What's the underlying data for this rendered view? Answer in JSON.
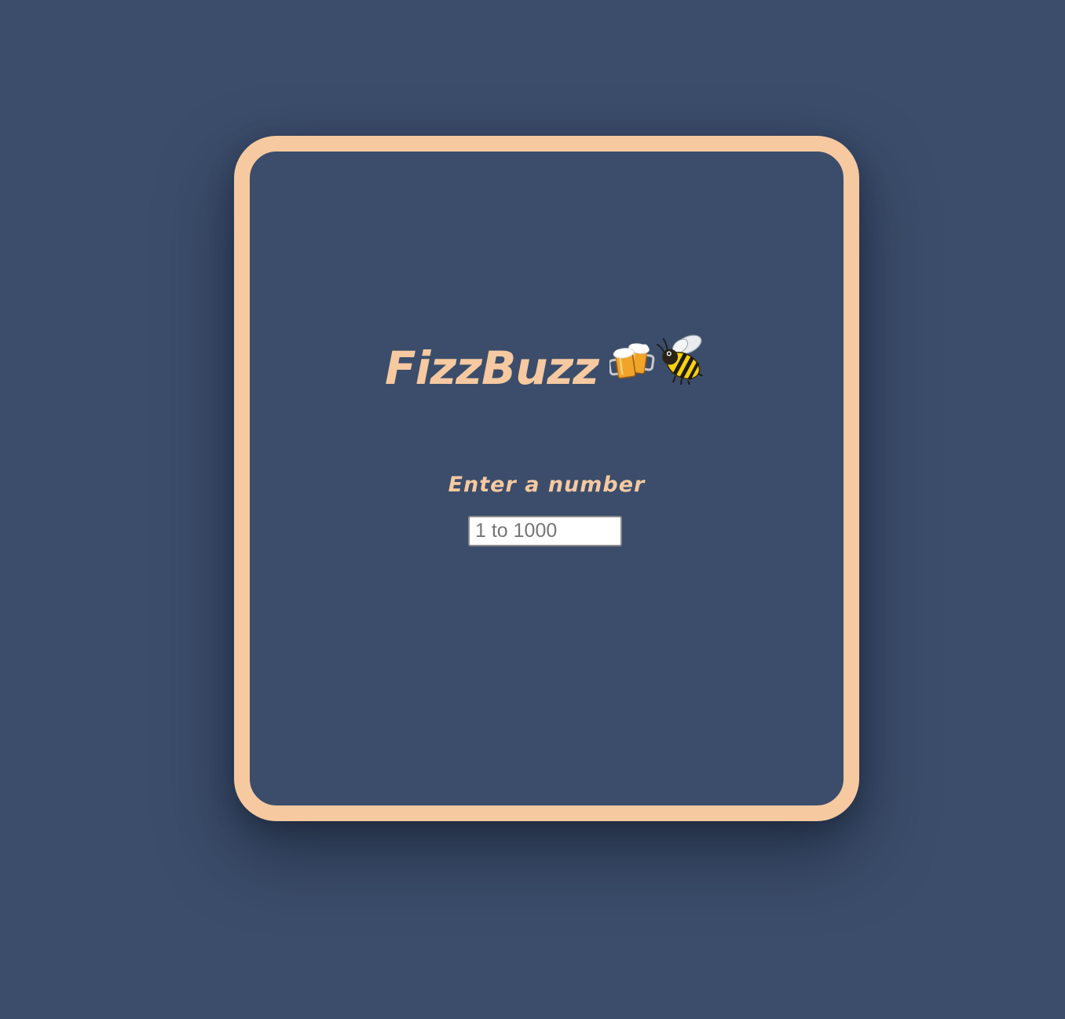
{
  "app": {
    "title": "FizzBuzz",
    "title_icons": [
      "beer-mugs-icon",
      "bee-icon"
    ]
  },
  "form": {
    "label": "Enter a number",
    "input": {
      "value": "",
      "placeholder": "1 to 1000"
    }
  },
  "colors": {
    "background": "#3b4d6b",
    "accent": "#f6c9a0",
    "input_background": "#ffffff"
  }
}
